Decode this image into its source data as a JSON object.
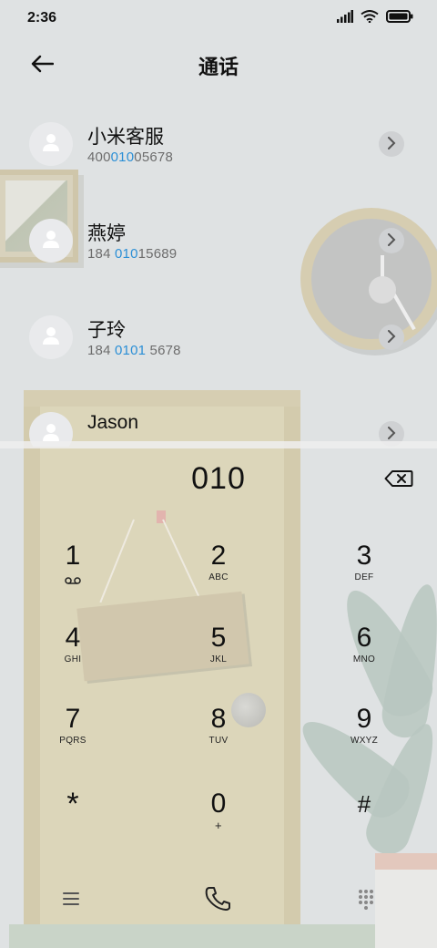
{
  "status_bar": {
    "time": "2:36",
    "icons": [
      "signal-icon",
      "wifi-icon",
      "battery-icon"
    ]
  },
  "header": {
    "title": "通话",
    "back_icon": "arrow-left-icon"
  },
  "contacts": [
    {
      "name": "小米客服",
      "number_pre": "400",
      "number_match": "010",
      "number_post": "05678"
    },
    {
      "name": "燕婷",
      "number_pre": "184 ",
      "number_match": "010",
      "number_post": "15689"
    },
    {
      "name": "子玲",
      "number_pre": "184 ",
      "number_match": "0101",
      "number_post": " 5678"
    },
    {
      "name": "Jason",
      "number_pre": "",
      "number_match": "",
      "number_post": ""
    }
  ],
  "dialer": {
    "input": "010",
    "keys": [
      {
        "digit": "1",
        "letters": ""
      },
      {
        "digit": "2",
        "letters": "ABC"
      },
      {
        "digit": "3",
        "letters": "DEF"
      },
      {
        "digit": "4",
        "letters": "GHI"
      },
      {
        "digit": "5",
        "letters": "JKL"
      },
      {
        "digit": "6",
        "letters": "MNO"
      },
      {
        "digit": "7",
        "letters": "PQRS"
      },
      {
        "digit": "8",
        "letters": "TUV"
      },
      {
        "digit": "9",
        "letters": "WXYZ"
      },
      {
        "digit": "*",
        "letters": ""
      },
      {
        "digit": "0",
        "letters": "+"
      },
      {
        "digit": "#",
        "letters": ""
      }
    ]
  },
  "colors": {
    "accent": "#2b8fd6",
    "background": "#dfe2e3"
  }
}
